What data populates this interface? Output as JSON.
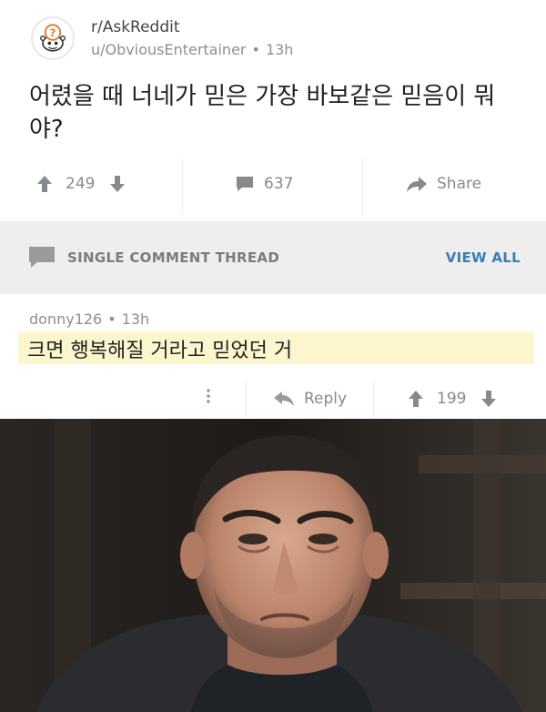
{
  "post": {
    "subreddit": "r/AskReddit",
    "author": "u/ObviousEntertainer",
    "age": "13h",
    "dot": "•",
    "title": "어렸을 때 너네가 믿은 가장 바보같은 믿음이 뭐야?",
    "upvotes": "249",
    "comments": "637",
    "share_label": "Share"
  },
  "thread_bar": {
    "label": "SINGLE COMMENT THREAD",
    "view_all": "VIEW ALL",
    "accent": "#3a7fb3"
  },
  "comment": {
    "author": "donny126",
    "dot": "•",
    "age": "13h",
    "body": "크면 행복해질 거라고 믿었던 거",
    "reply_label": "Reply",
    "score": "199",
    "highlight": "#fbf6cd"
  },
  "icons": [
    "snoo-question-avatar-icon",
    "upvote-arrow-icon",
    "downvote-arrow-icon",
    "comment-bubble-icon",
    "share-arrow-icon",
    "more-dots-icon",
    "reply-arrow-icon"
  ]
}
